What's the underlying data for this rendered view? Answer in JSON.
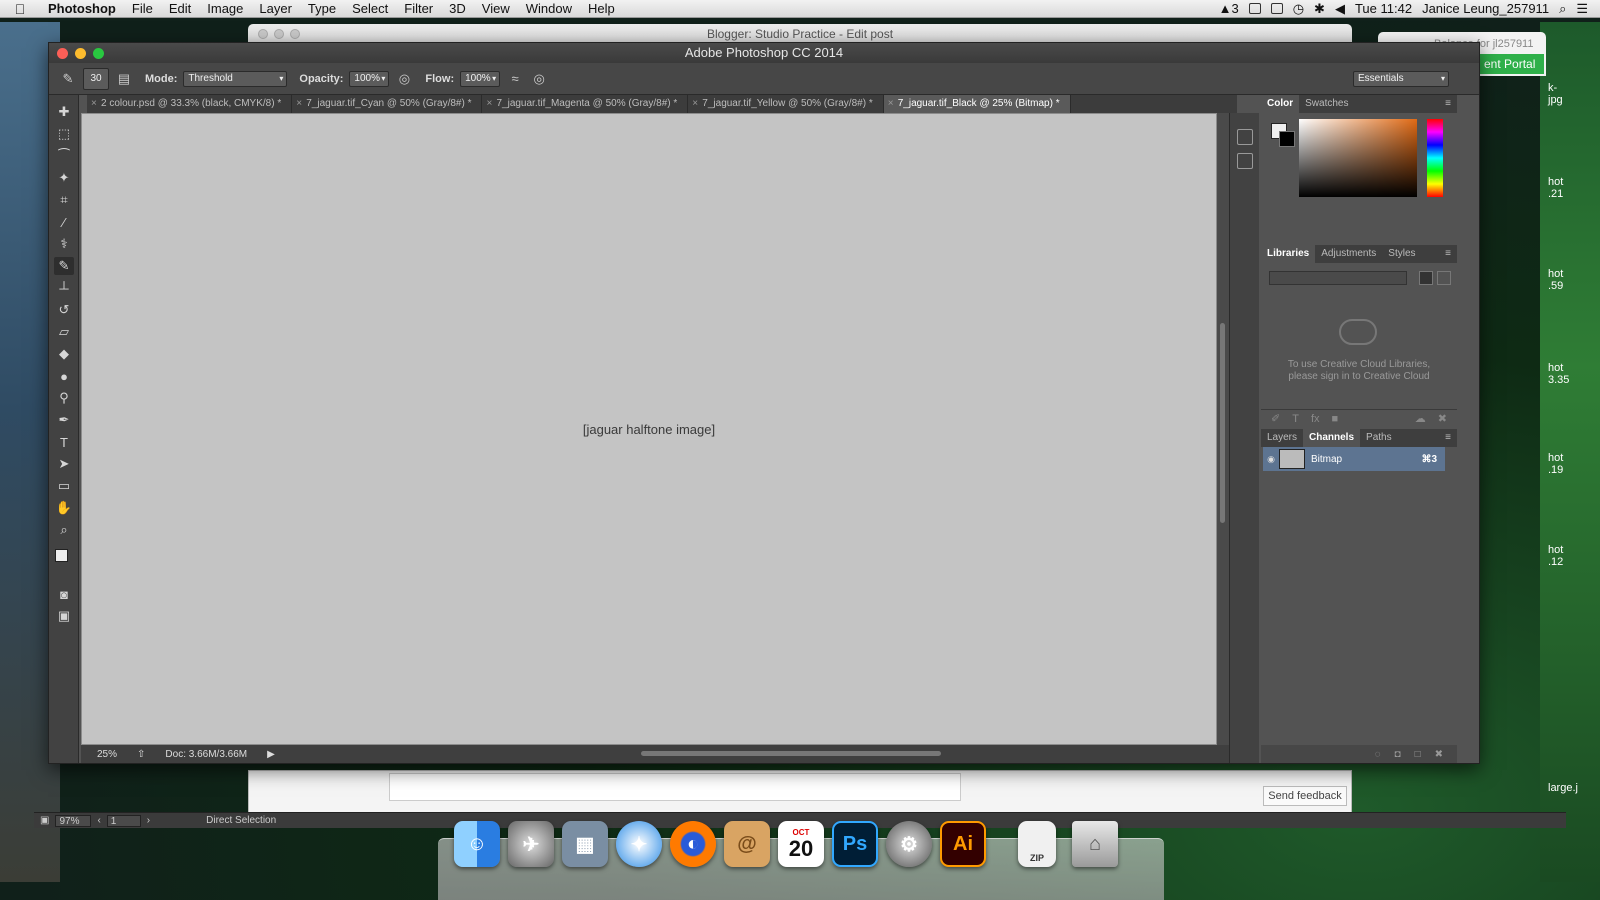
{
  "menubar": {
    "app_name": "Photoshop",
    "items": [
      "File",
      "Edit",
      "Image",
      "Layer",
      "Type",
      "Select",
      "Filter",
      "3D",
      "View",
      "Window",
      "Help"
    ],
    "clock": "Tue 11:42",
    "user": "Janice Leung_257911",
    "adobe_badge": "3"
  },
  "background_windows": {
    "blogger_title": "Blogger: Studio Practice - Edit post",
    "portal_title": "Balance for jl257911",
    "portal_button": "ent Portal",
    "send_feedback": "Send feedback",
    "right_peek": [
      "hot",
      ".21",
      "hot",
      ".59",
      "hot",
      "3.35",
      "hot",
      ".19",
      "hot",
      ".12",
      "large.j"
    ],
    "top_right_peek": [
      "k-",
      "jpg"
    ]
  },
  "illustrator_status": {
    "zoom": "97%",
    "page": "1",
    "tool": "Direct Selection"
  },
  "photoshop": {
    "window_title": "Adobe Photoshop CC 2014",
    "options": {
      "brush_size": "30",
      "mode_label": "Mode:",
      "mode_value": "Threshold",
      "opacity_label": "Opacity:",
      "opacity_value": "100%",
      "flow_label": "Flow:",
      "flow_value": "100%",
      "workspace": "Essentials"
    },
    "tabs": [
      {
        "label": "2 colour.psd @ 33.3% (black, CMYK/8) *",
        "active": false
      },
      {
        "label": "7_jaguar.tif_Cyan @ 50% (Gray/8#) *",
        "active": false
      },
      {
        "label": "7_jaguar.tif_Magenta @ 50% (Gray/8#) *",
        "active": false
      },
      {
        "label": "7_jaguar.tif_Yellow @ 50% (Gray/8#) *",
        "active": false
      },
      {
        "label": "7_jaguar.tif_Black @ 25% (Bitmap) *",
        "active": true
      }
    ],
    "canvas_description": "halftone bitmap of a jaguar face",
    "status": {
      "zoom": "25%",
      "doc": "Doc: 3.66M/3.66M"
    },
    "panels": {
      "color_tabs": [
        "Color",
        "Swatches"
      ],
      "library_tabs": [
        "Libraries",
        "Adjustments",
        "Styles"
      ],
      "library_message_line1": "To use Creative Cloud Libraries,",
      "library_message_line2": "please sign in to Creative Cloud",
      "channel_tabs": [
        "Layers",
        "Channels",
        "Paths"
      ],
      "channel_name": "Bitmap",
      "channel_shortcut": "⌘3"
    }
  },
  "dock": {
    "calendar_month": "OCT",
    "calendar_day": "20",
    "ps_label": "Ps",
    "ai_label": "Ai",
    "zip_label": "ZIP"
  },
  "colors": {
    "ps_panel": "#535353",
    "selected_channel": "#5d7491",
    "illustrator_orange": "#ff9a00",
    "photoshop_blue": "#31a8ff"
  }
}
